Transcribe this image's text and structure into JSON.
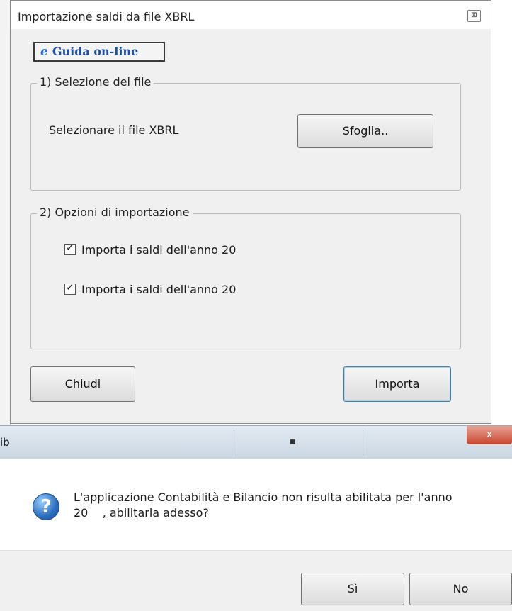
{
  "dialog": {
    "title": "Importazione saldi da file XBRL",
    "close_glyph": "⊠",
    "help_label": "Guida on-line",
    "help_icon_glyph": "e",
    "group_file": {
      "legend": "1) Selezione del file",
      "file_label": "Selezionare il file XBRL",
      "browse_label": "Sfoglia.."
    },
    "group_options": {
      "legend": "2) Opzioni di importazione",
      "options": [
        {
          "label": "Importa i saldi dell'anno 20",
          "checked": true
        },
        {
          "label": "Importa i saldi dell'anno 20",
          "checked": true
        }
      ]
    },
    "close_label": "Chiudi",
    "import_label": "Importa"
  },
  "msgbox": {
    "title": "ib",
    "close_glyph": "x",
    "icon": "question-icon",
    "message_line1": "L'applicazione Contabilità e Bilancio non risulta abilitata per l'anno",
    "message_line2": "20    , abilitarla adesso?",
    "yes_label": "Sì",
    "no_label": "No"
  },
  "colors": {
    "dialog_bg": "#f0f0f0",
    "help_text": "#1f4fa0",
    "msg_close": "#c8452e"
  }
}
